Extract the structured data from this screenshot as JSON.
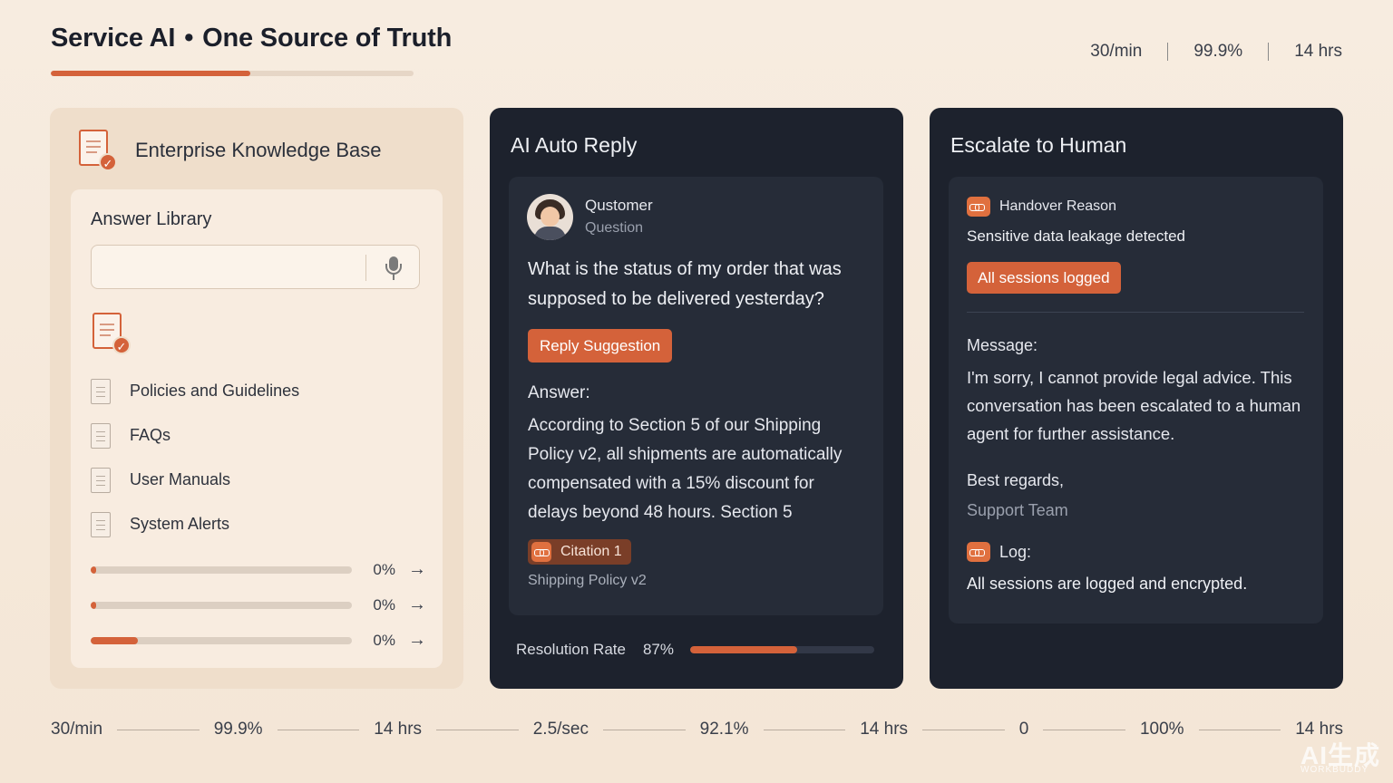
{
  "header": {
    "title_left": "Service AI",
    "separator": "•",
    "title_right": "One Source of Truth",
    "title_progress": 0.55,
    "stats": [
      "30/min",
      "99.9%",
      "14 hrs"
    ]
  },
  "knowledge_base": {
    "title": "Enterprise Knowledge Base",
    "library_title": "Answer Library",
    "search_placeholder": "",
    "documents": [
      {
        "label": "Policies and Guidelines"
      },
      {
        "label": "FAQs"
      },
      {
        "label": "User Manuals"
      },
      {
        "label": "System Alerts"
      }
    ],
    "progress": [
      {
        "pct": "0%",
        "fill": 0.02
      },
      {
        "pct": "0%",
        "fill": 0.02
      },
      {
        "pct": "0%",
        "fill": 0.18
      }
    ]
  },
  "ai_reply": {
    "title": "AI Auto Reply",
    "customer_name": "Qustomer",
    "customer_sub": "Question",
    "question": "What is the status of my order that was supposed to be delivered yesterday?",
    "reply_button": "Reply Suggestion",
    "answer_label": "Answer:",
    "answer_text": "According to Section 5 of our Shipping Policy v2, all shipments are automatically compensated with a 15% discount for delays beyond 48 hours. Section 5",
    "citation_label": "Citation 1",
    "citation_source": "Shipping Policy v2",
    "resolution_label": "Resolution Rate",
    "resolution_pct": "87%",
    "resolution_fill": 0.58
  },
  "escalate": {
    "title": "Escalate to Human",
    "handover_label": "Handover Reason",
    "reason": "Sensitive data leakage detected",
    "logged_button": "All sessions logged",
    "message_label": "Message:",
    "message_text": "I'm sorry, I cannot provide legal advice. This conversation has been escalated to a human agent for further assistance.",
    "regards": "Best regards,",
    "team": "Support Team",
    "log_label": "Log:",
    "log_text": "All sessions are logged and encrypted."
  },
  "bottom_stats": [
    "30/min",
    "99.9%",
    "14 hrs",
    "2.5/sec",
    "92.1%",
    "14 hrs",
    "0",
    "100%",
    "14 hrs"
  ],
  "watermark": {
    "main": "AI生成",
    "sub": "WORKBUDDY"
  },
  "colors": {
    "accent": "#d4623a",
    "dark_panel": "#1d222d",
    "card": "#262c38",
    "background": "#f6e9dc"
  }
}
